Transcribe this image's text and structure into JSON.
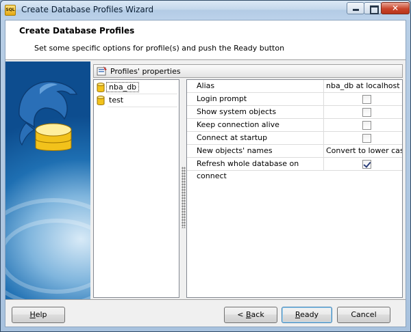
{
  "window": {
    "title": "Create Database Profiles Wizard",
    "app_icon_label": "SQL",
    "close_symbol": "✕"
  },
  "header": {
    "title": "Create Database Profiles",
    "subtitle": "Set some specific options for profile(s) and push the Ready button"
  },
  "panel": {
    "title": "Profiles' properties"
  },
  "profiles": [
    {
      "name": "nba_db",
      "selected": true
    },
    {
      "name": "test",
      "selected": false
    }
  ],
  "properties": [
    {
      "key": "Alias",
      "value": "nba_db at localhost",
      "type": "text"
    },
    {
      "key": "Login prompt",
      "checked": false,
      "type": "checkbox"
    },
    {
      "key": "Show system objects",
      "checked": false,
      "type": "checkbox"
    },
    {
      "key": "Keep connection alive",
      "checked": false,
      "type": "checkbox"
    },
    {
      "key": "Connect at startup",
      "checked": false,
      "type": "checkbox"
    },
    {
      "key": "New objects' names",
      "value": "Convert to lower case",
      "type": "text"
    },
    {
      "key": "Refresh whole database on connect",
      "checked": true,
      "type": "checkbox"
    }
  ],
  "buttons": {
    "help": {
      "mnemonic": "H",
      "rest": "elp"
    },
    "back": {
      "prefix": "< ",
      "mnemonic": "B",
      "rest": "ack"
    },
    "ready": {
      "mnemonic": "R",
      "rest": "eady"
    },
    "cancel": {
      "label": "Cancel"
    }
  },
  "colors": {
    "sidebar_dark": "#0d4d8f",
    "sidebar_light": "#d8eaf7",
    "db_gold": "#f2c21b"
  }
}
